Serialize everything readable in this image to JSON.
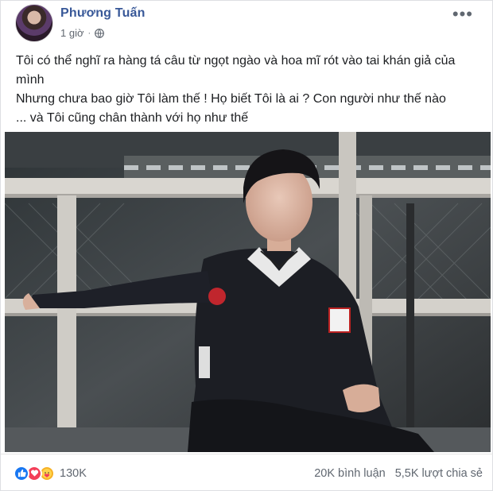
{
  "post": {
    "author": "Phương Tuấn",
    "time": "1 giờ",
    "separator": "·",
    "more_label": "•••",
    "text_lines": [
      "Tôi có thể nghĩ ra hàng tá câu từ ngọt ngào và hoa mĩ rót vào tai khán giả của mình",
      "Nhưng chưa bao giờ Tôi làm thế ! Họ biết Tôi là ai ? Con người như thế nào",
      "... và Tôi cũng chân thành với họ như thế"
    ]
  },
  "footer": {
    "reaction_icons": [
      "like-icon",
      "love-icon",
      "care-icon"
    ],
    "reaction_count": "130K",
    "comments": "20K bình luận",
    "shares": "5,5K lượt chia sẻ"
  },
  "colors": {
    "author_blue": "#385898",
    "like_blue": "#1877f2",
    "love_red": "#f33e58",
    "care_yellow": "#f7b125"
  }
}
